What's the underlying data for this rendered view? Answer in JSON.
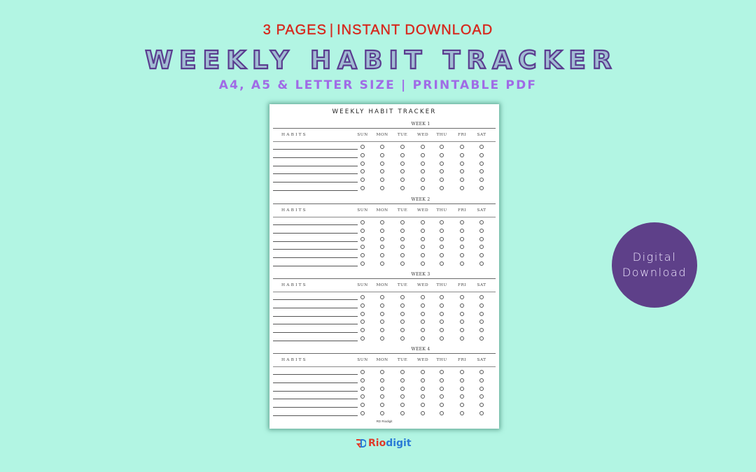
{
  "header": {
    "top_left": "3 PAGES",
    "top_sep": "|",
    "top_right": "INSTANT DOWNLOAD",
    "title": "WEEKLY HABIT TRACKER",
    "subtitle": "A4, A5 & LETTER SIZE | PRINTABLE PDF"
  },
  "sheet": {
    "title": "WEEKLY HABIT TRACKER",
    "habits_label": "HABITS",
    "days": [
      "SUN",
      "MON",
      "TUE",
      "WED",
      "THU",
      "FRI",
      "SAT"
    ],
    "weeks": [
      "WEEK 1",
      "WEEK 2",
      "WEEK 3",
      "WEEK 4"
    ],
    "rows_per_week": 6,
    "footer": "RD Riodigit"
  },
  "badge": {
    "line1": "Digital",
    "line2": "Download"
  },
  "brand": {
    "part1": "Rio",
    "part2": "digit"
  },
  "colors": {
    "background": "#b2f5e3",
    "top_line": "#d62a1f",
    "title": "#5a3d8f",
    "subtitle": "#a06be6",
    "badge": "#5e4089",
    "brand_red": "#e03a2a",
    "brand_blue": "#2a7bd6"
  }
}
